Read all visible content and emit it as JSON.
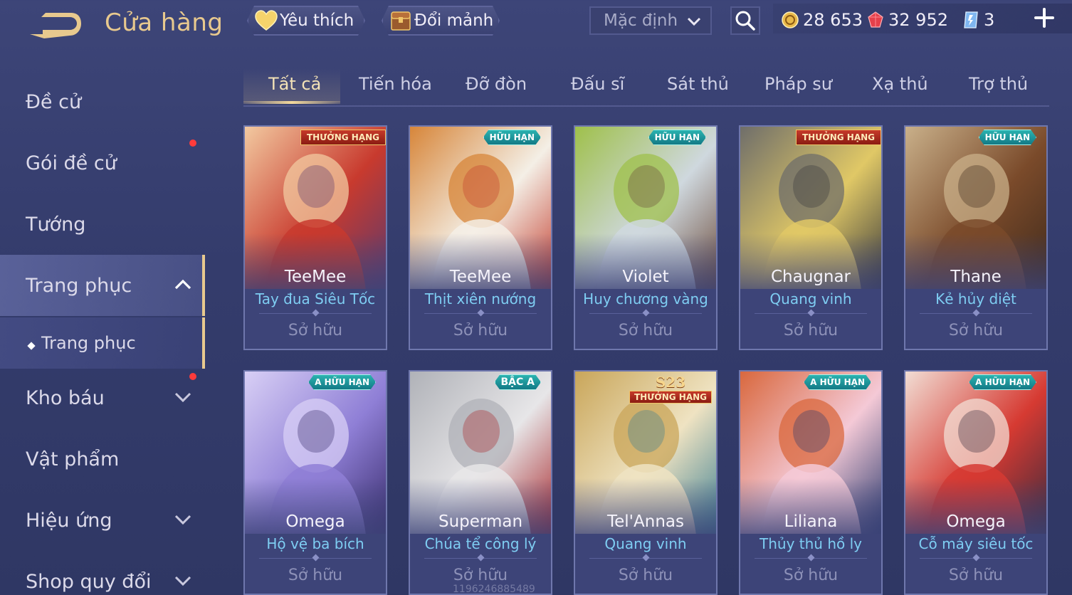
{
  "header": {
    "title": "Cửa hàng",
    "favorites_label": "Yêu thích",
    "exchange_label": "Đổi mảnh",
    "sort_selected": "Mặc định"
  },
  "currencies": {
    "gold": "28 653",
    "ruby": "32 952",
    "gem": "3"
  },
  "sidebar": {
    "items": [
      {
        "label": "Đề cử"
      },
      {
        "label": "Gói đề cử"
      },
      {
        "label": "Tướng"
      },
      {
        "label": "Trang phục"
      },
      {
        "label": "Trang phục"
      },
      {
        "label": "Kho báu"
      },
      {
        "label": "Vật phẩm"
      },
      {
        "label": "Hiệu ứng"
      },
      {
        "label": "Shop quy đổi"
      }
    ]
  },
  "tabs": [
    {
      "label": "Tất cả"
    },
    {
      "label": "Tiến hóa"
    },
    {
      "label": "Đỡ đòn"
    },
    {
      "label": "Đấu sĩ"
    },
    {
      "label": "Sát thủ"
    },
    {
      "label": "Pháp sư"
    },
    {
      "label": "Xạ thủ"
    },
    {
      "label": "Trợ thủ"
    }
  ],
  "cards": [
    {
      "hero": "TeeMee",
      "skin": "Tay đua Siêu Tốc",
      "status": "Sở hữu",
      "badge": "THƯỞNG HẠNG",
      "palette": [
        "#c83a2e",
        "#f2c9a0",
        "#5b3a6e"
      ]
    },
    {
      "hero": "TeeMee",
      "skin": "Thịt xiên nướng",
      "status": "Sở hữu",
      "badge": "HỮU HẠN",
      "palette": [
        "#f4efe6",
        "#d7863a",
        "#c23b2c"
      ]
    },
    {
      "hero": "Violet",
      "skin": "Huy chương vàng",
      "status": "Sở hữu",
      "badge": "HỮU HẠN",
      "palette": [
        "#cfd8de",
        "#9fc04b",
        "#6b4a3a"
      ]
    },
    {
      "hero": "Chaugnar",
      "skin": "Quang vinh",
      "status": "Sở hữu",
      "badge": "THƯỞNG HẠNG",
      "palette": [
        "#e0c866",
        "#6f6e6a",
        "#3a3a3c"
      ]
    },
    {
      "hero": "Thane",
      "skin": "Kẻ hủy diệt",
      "status": "Sở hữu",
      "badge": "HỮU HẠN",
      "palette": [
        "#7a4a2a",
        "#c9b08a",
        "#3f2a1c"
      ]
    },
    {
      "hero": "Omega",
      "skin": "Hộ vệ ba bích",
      "status": "Sở hữu",
      "badge": "A HỮU HẠN",
      "palette": [
        "#8f7fd6",
        "#d8cff5",
        "#3a2d6e"
      ]
    },
    {
      "hero": "Superman",
      "skin": "Chúa tể công lý",
      "status": "Sở hữu",
      "badge": "BẬC A",
      "palette": [
        "#e7e6e8",
        "#b0b2b8",
        "#a8282c"
      ]
    },
    {
      "hero": "Tel'Annas",
      "skin": "Quang vinh",
      "status": "Sở hữu",
      "badge": "S23 THƯỞNG HẠNG",
      "palette": [
        "#efe3c2",
        "#c9a65a",
        "#3d7f92"
      ]
    },
    {
      "hero": "Liliana",
      "skin": "Thủy thủ hồ ly",
      "status": "Sở hữu",
      "badge": "A HỮU HẠN",
      "palette": [
        "#f4c9d6",
        "#d9683e",
        "#2c3a6e"
      ]
    },
    {
      "hero": "Omega",
      "skin": "Cỗ máy siêu tốc",
      "status": "Sở hữu",
      "badge": "A HỮU HẠN",
      "palette": [
        "#d63a32",
        "#f1ddd4",
        "#3a2a3c"
      ]
    }
  ],
  "watermark": "1196246885489",
  "colors": {
    "accent_gold": "#e8c98e",
    "skin_name_cyan": "#7ecdf2",
    "notification_red": "#ff3b3b"
  }
}
